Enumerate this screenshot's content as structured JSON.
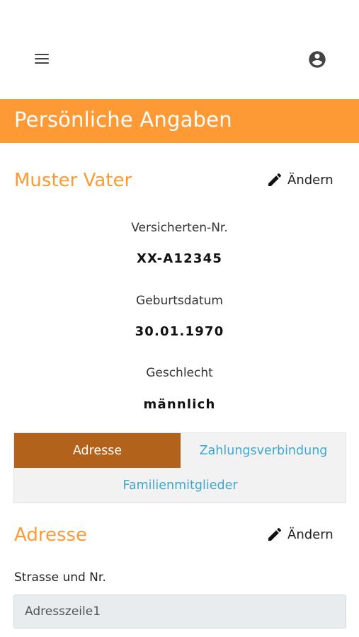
{
  "header": {
    "menu_icon": "menu-icon",
    "account_icon": "account-circle-icon"
  },
  "page": {
    "title": "Persönliche Angaben",
    "banner_color": "#fd9a35"
  },
  "person": {
    "name": "Muster Vater",
    "edit_label": "Ändern",
    "fields": [
      {
        "label": "Versicherten-Nr.",
        "value": "XX-A12345"
      },
      {
        "label": "Geburtsdatum",
        "value": "30.01.1970"
      },
      {
        "label": "Geschlecht",
        "value": "männlich"
      }
    ]
  },
  "tabs": {
    "items": [
      {
        "label": "Adresse",
        "active": true
      },
      {
        "label": "Zahlungsverbindung",
        "active": false
      },
      {
        "label": "Familienmitglieder",
        "active": false
      }
    ],
    "active_color": "#b2621a",
    "link_color": "#3fa7cf"
  },
  "address": {
    "title": "Adresse",
    "edit_label": "Ändern",
    "street_label": "Strasse und Nr.",
    "street_value": "Adresszeile1"
  }
}
